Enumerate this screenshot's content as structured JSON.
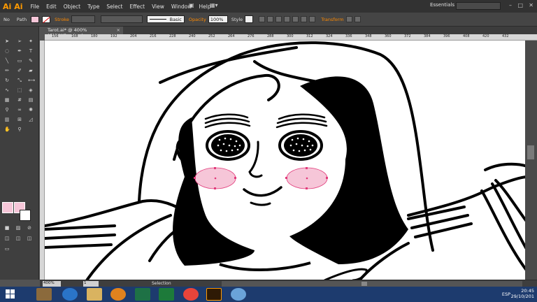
{
  "app": {
    "logo_left": "Ai",
    "logo_right": "Ai"
  },
  "menu": [
    "File",
    "Edit",
    "Object",
    "Type",
    "Select",
    "Effect",
    "View",
    "Window",
    "Help"
  ],
  "workspace": "Essentials",
  "control_bar": {
    "selection_type": "No",
    "object_type": "Path",
    "stroke_label": "Stroke",
    "brush_style": "Basic",
    "opacity_label": "Opacity",
    "opacity_value": "100%",
    "style_label": "Style",
    "transform_label": "Transform"
  },
  "document_tab": {
    "title": "Tarot.ai* @ 400% (CMYK/Preview)",
    "close": "×"
  },
  "ruler_ticks": [
    "156",
    "168",
    "180",
    "192",
    "204",
    "216",
    "228",
    "240",
    "252",
    "264",
    "276",
    "288",
    "300",
    "312",
    "324",
    "336",
    "348",
    "360",
    "372",
    "384",
    "396",
    "408",
    "420",
    "432"
  ],
  "status": {
    "zoom": "400%",
    "page": "1",
    "tool": "Selection"
  },
  "taskbar": {
    "lang": "ESP",
    "time": "20:45",
    "date": "29/10/201"
  },
  "colors": {
    "accent": "#ff9a00",
    "fill_pink": "#f6c6d8",
    "taskbar": "#1d3b6e"
  }
}
